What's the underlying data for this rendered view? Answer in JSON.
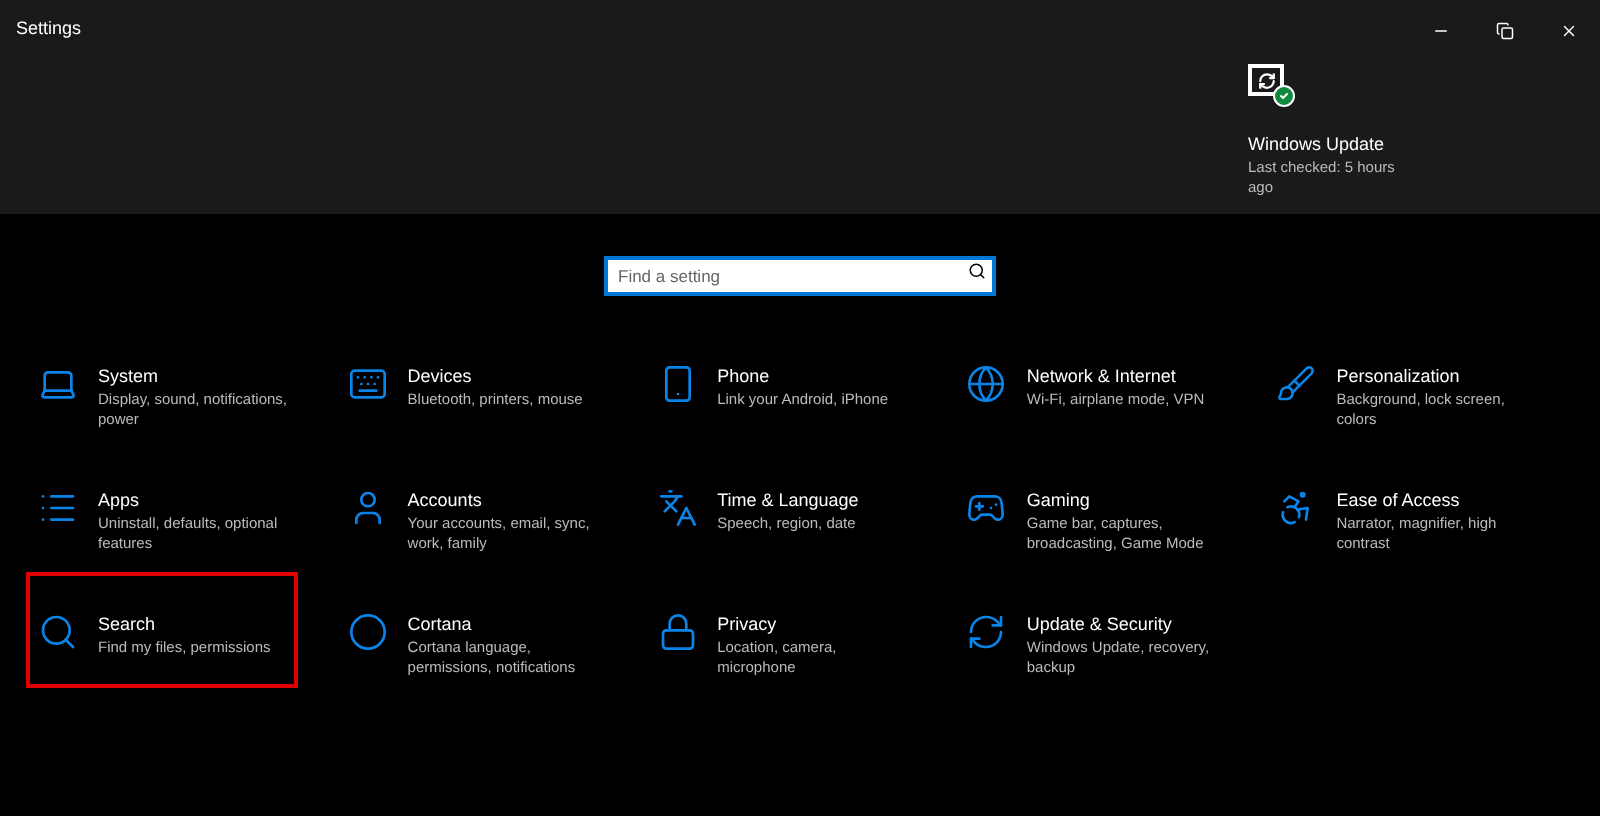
{
  "window": {
    "title": "Settings"
  },
  "update_status": {
    "title": "Windows Update",
    "subtitle": "Last checked: 5 hours ago"
  },
  "search": {
    "placeholder": "Find a setting"
  },
  "categories": [
    {
      "title": "System",
      "description": "Display, sound, notifications, power",
      "highlighted": false
    },
    {
      "title": "Devices",
      "description": "Bluetooth, printers, mouse",
      "highlighted": false
    },
    {
      "title": "Phone",
      "description": "Link your Android, iPhone",
      "highlighted": false
    },
    {
      "title": "Network & Internet",
      "description": "Wi-Fi, airplane mode, VPN",
      "highlighted": false
    },
    {
      "title": "Personalization",
      "description": "Background, lock screen, colors",
      "highlighted": false
    },
    {
      "title": "Apps",
      "description": "Uninstall, defaults, optional features",
      "highlighted": false
    },
    {
      "title": "Accounts",
      "description": "Your accounts, email, sync, work, family",
      "highlighted": false
    },
    {
      "title": "Time & Language",
      "description": "Speech, region, date",
      "highlighted": false
    },
    {
      "title": "Gaming",
      "description": "Game bar, captures, broadcasting, Game Mode",
      "highlighted": false
    },
    {
      "title": "Ease of Access",
      "description": "Narrator, magnifier, high contrast",
      "highlighted": false
    },
    {
      "title": "Search",
      "description": "Find my files, permissions",
      "highlighted": true
    },
    {
      "title": "Cortana",
      "description": "Cortana language, permissions, notifications",
      "highlighted": false
    },
    {
      "title": "Privacy",
      "description": "Location, camera, microphone",
      "highlighted": false
    },
    {
      "title": "Update & Security",
      "description": "Windows Update, recovery, backup",
      "highlighted": false
    }
  ]
}
